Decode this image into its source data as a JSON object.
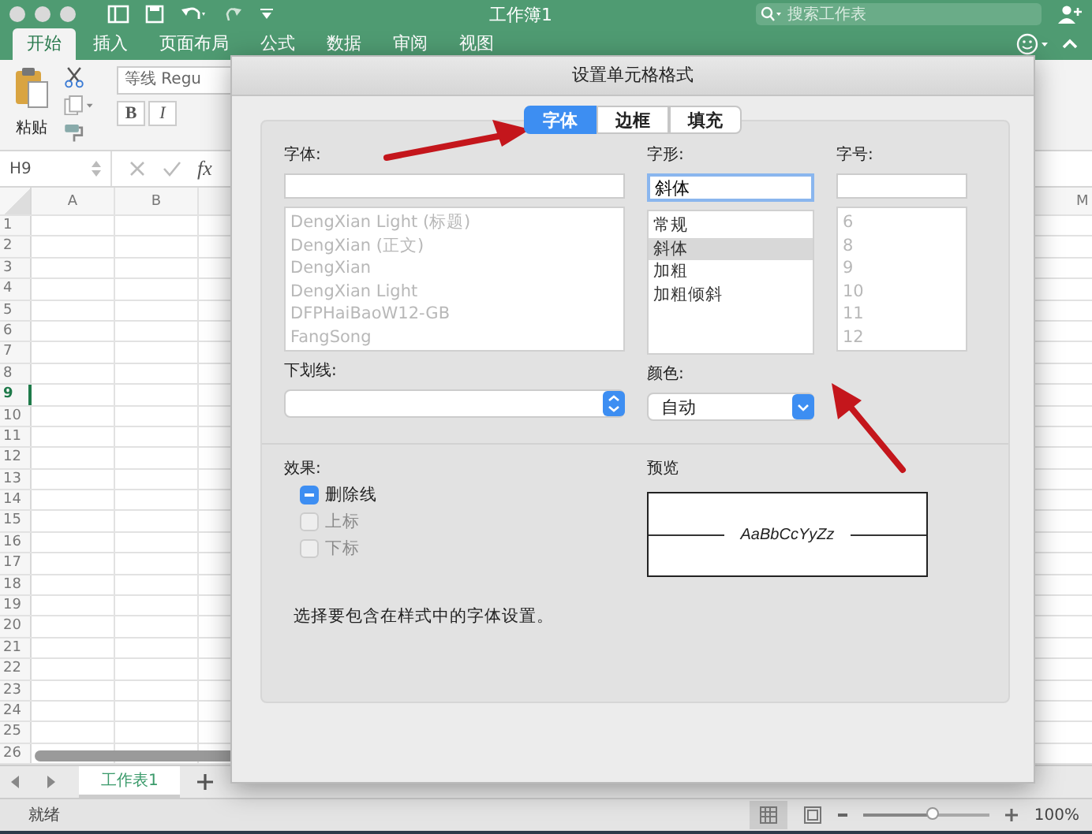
{
  "window": {
    "title": "工作簿1",
    "search_placeholder": "搜索工作表"
  },
  "ribbon_tabs": [
    {
      "label": "开始",
      "selected": true
    },
    {
      "label": "插入",
      "selected": false
    },
    {
      "label": "页面布局",
      "selected": false
    },
    {
      "label": "公式",
      "selected": false
    },
    {
      "label": "数据",
      "selected": false
    },
    {
      "label": "审阅",
      "selected": false
    },
    {
      "label": "视图",
      "selected": false
    }
  ],
  "ribbon": {
    "paste_label": "粘贴",
    "font_name": "等线 Regu",
    "bold": "B",
    "italic": "I"
  },
  "formula_bar": {
    "cell": "H9",
    "fx": "fx"
  },
  "sheet": {
    "columns": [
      "A",
      "B"
    ],
    "right_column": "M",
    "rows": [
      {
        "label": "1",
        "selected": false
      },
      {
        "label": "2",
        "selected": false
      },
      {
        "label": "3",
        "selected": false
      },
      {
        "label": "4",
        "selected": false
      },
      {
        "label": "5",
        "selected": false
      },
      {
        "label": "6",
        "selected": false
      },
      {
        "label": "7",
        "selected": false
      },
      {
        "label": "8",
        "selected": false
      },
      {
        "label": "9",
        "selected": true
      },
      {
        "label": "10",
        "selected": false
      },
      {
        "label": "11",
        "selected": false
      },
      {
        "label": "12",
        "selected": false
      },
      {
        "label": "13",
        "selected": false
      },
      {
        "label": "14",
        "selected": false
      },
      {
        "label": "15",
        "selected": false
      },
      {
        "label": "16",
        "selected": false
      },
      {
        "label": "17",
        "selected": false
      },
      {
        "label": "18",
        "selected": false
      },
      {
        "label": "19",
        "selected": false
      },
      {
        "label": "20",
        "selected": false
      },
      {
        "label": "21",
        "selected": false
      },
      {
        "label": "22",
        "selected": false
      },
      {
        "label": "23",
        "selected": false
      },
      {
        "label": "24",
        "selected": false
      },
      {
        "label": "25",
        "selected": false
      },
      {
        "label": "26",
        "selected": false
      }
    ]
  },
  "dialog": {
    "title": "设置单元格格式",
    "tabs": [
      {
        "label": "字体",
        "selected": true
      },
      {
        "label": "边框",
        "selected": false
      },
      {
        "label": "填充",
        "selected": false
      }
    ],
    "font_label": "字体:",
    "font_list": [
      "DengXian Light (标题)",
      "DengXian (正文)",
      "DengXian",
      "DengXian Light",
      "DFPHaiBaoW12-GB",
      "FangSong"
    ],
    "style_label": "字形:",
    "style_value": "斜体",
    "style_list": [
      {
        "label": "常规",
        "selected": false
      },
      {
        "label": "斜体",
        "selected": true
      },
      {
        "label": "加粗",
        "selected": false
      },
      {
        "label": "加粗倾斜",
        "selected": false
      }
    ],
    "size_label": "字号:",
    "size_list": [
      "6",
      "8",
      "9",
      "10",
      "11",
      "12"
    ],
    "underline_label": "下划线:",
    "color_label": "颜色:",
    "color_value": "自动",
    "effects_label": "效果:",
    "effects": [
      {
        "label": "删除线",
        "checked": true,
        "disabled": false
      },
      {
        "label": "上标",
        "checked": false,
        "disabled": true
      },
      {
        "label": "下标",
        "checked": false,
        "disabled": true
      }
    ],
    "preview_label": "预览",
    "preview_text": "AaBbCcYyZz",
    "hint": "选择要包含在样式中的字体设置。"
  },
  "sheet_tabs": [
    {
      "label": "工作表1",
      "selected": true
    }
  ],
  "status_bar": {
    "text": "就绪",
    "level": 0.55,
    "zoom": "100%"
  }
}
